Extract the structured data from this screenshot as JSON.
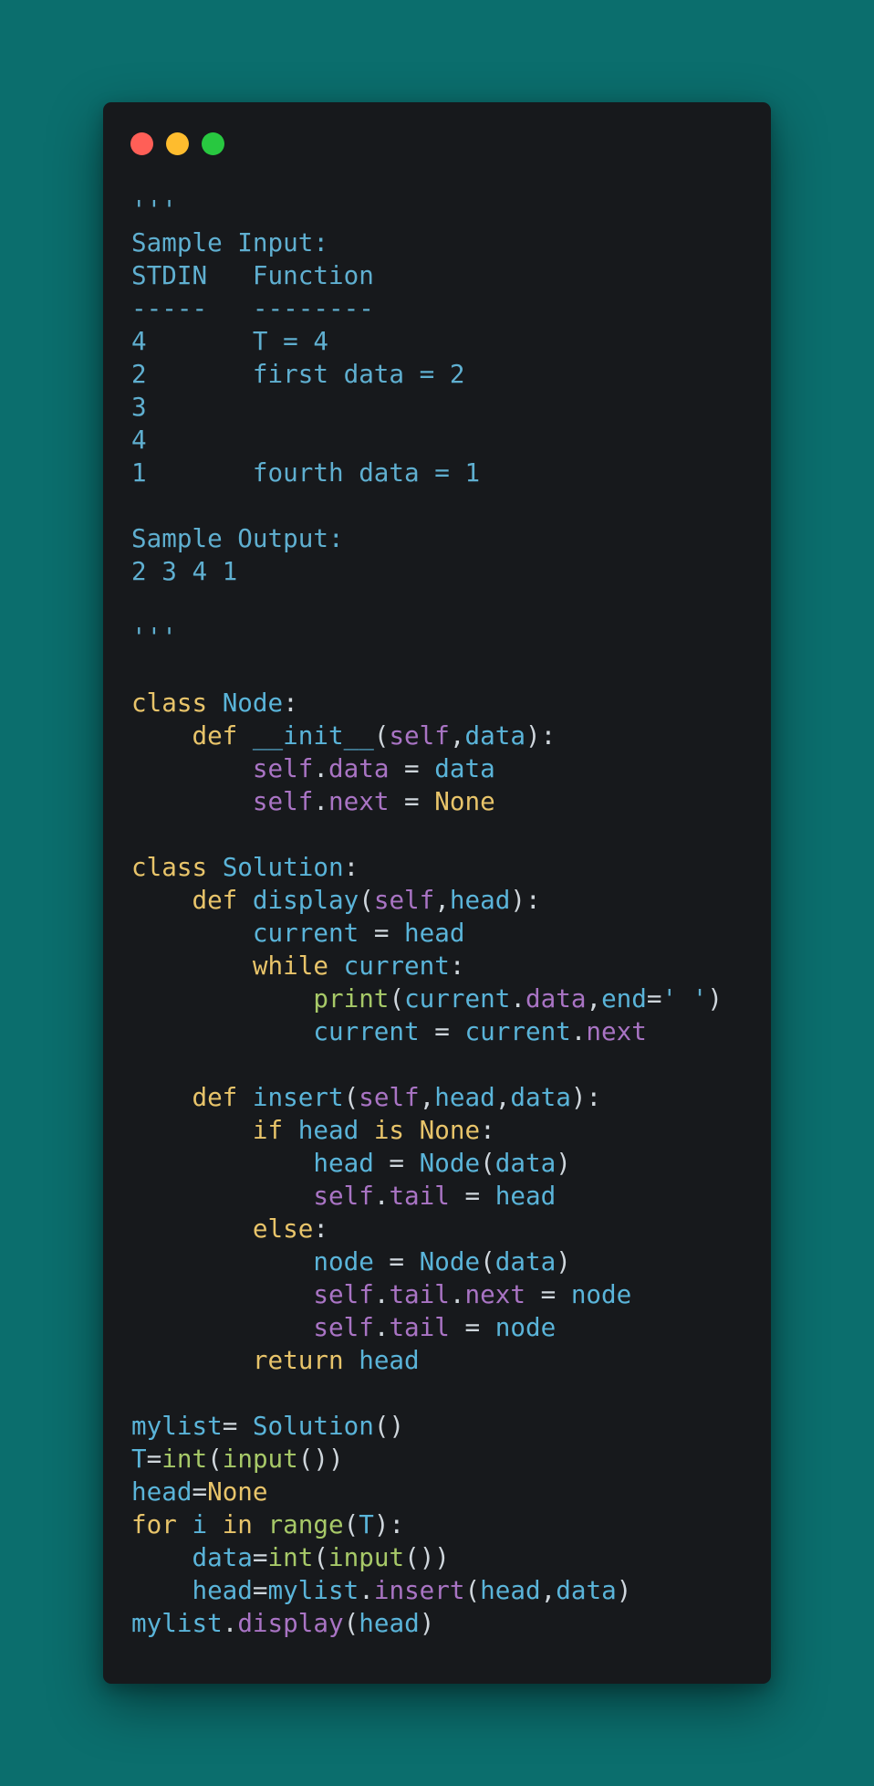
{
  "window": {
    "dots": [
      "close",
      "minimize",
      "zoom"
    ],
    "colors": {
      "background": "#0b6e6d",
      "card": "#17191c",
      "red": "#ff5f57",
      "yellow": "#febc2e",
      "green": "#28c840"
    }
  },
  "code_lines": [
    [
      [
        "str",
        "'''"
      ]
    ],
    [
      [
        "str",
        "Sample Input:"
      ]
    ],
    [
      [
        "str",
        "STDIN   Function"
      ]
    ],
    [
      [
        "str",
        "-----   --------"
      ]
    ],
    [
      [
        "str",
        "4       T = 4"
      ]
    ],
    [
      [
        "str",
        "2       first data = 2"
      ]
    ],
    [
      [
        "str",
        "3"
      ]
    ],
    [
      [
        "str",
        "4"
      ]
    ],
    [
      [
        "str",
        "1       fourth data = 1"
      ]
    ],
    [],
    [
      [
        "str",
        "Sample Output:"
      ]
    ],
    [
      [
        "str",
        "2 3 4 1"
      ]
    ],
    [],
    [
      [
        "str",
        "'''"
      ]
    ],
    [],
    [
      [
        "kw",
        "class "
      ],
      [
        "name",
        "Node"
      ],
      [
        "punc",
        ":"
      ]
    ],
    [
      [
        "plain",
        "    "
      ],
      [
        "kw",
        "def "
      ],
      [
        "func",
        "__init__"
      ],
      [
        "punc",
        "("
      ],
      [
        "self",
        "self"
      ],
      [
        "punc",
        ","
      ],
      [
        "name",
        "data"
      ],
      [
        "punc",
        "):"
      ]
    ],
    [
      [
        "plain",
        "        "
      ],
      [
        "self",
        "self"
      ],
      [
        "punc",
        "."
      ],
      [
        "attr",
        "data"
      ],
      [
        "op",
        " = "
      ],
      [
        "name",
        "data"
      ]
    ],
    [
      [
        "plain",
        "        "
      ],
      [
        "self",
        "self"
      ],
      [
        "punc",
        "."
      ],
      [
        "attr",
        "next"
      ],
      [
        "op",
        " = "
      ],
      [
        "const",
        "None"
      ]
    ],
    [],
    [
      [
        "kw",
        "class "
      ],
      [
        "name",
        "Solution"
      ],
      [
        "punc",
        ":"
      ]
    ],
    [
      [
        "plain",
        "    "
      ],
      [
        "kw",
        "def "
      ],
      [
        "func",
        "display"
      ],
      [
        "punc",
        "("
      ],
      [
        "self",
        "self"
      ],
      [
        "punc",
        ","
      ],
      [
        "name",
        "head"
      ],
      [
        "punc",
        "):"
      ]
    ],
    [
      [
        "plain",
        "        "
      ],
      [
        "name",
        "current"
      ],
      [
        "op",
        " = "
      ],
      [
        "name",
        "head"
      ]
    ],
    [
      [
        "plain",
        "        "
      ],
      [
        "kw",
        "while "
      ],
      [
        "name",
        "current"
      ],
      [
        "punc",
        ":"
      ]
    ],
    [
      [
        "plain",
        "            "
      ],
      [
        "builtin",
        "print"
      ],
      [
        "punc",
        "("
      ],
      [
        "name",
        "current"
      ],
      [
        "punc",
        "."
      ],
      [
        "attr",
        "data"
      ],
      [
        "punc",
        ","
      ],
      [
        "name",
        "end"
      ],
      [
        "op",
        "="
      ],
      [
        "str",
        "' '"
      ],
      [
        "punc",
        ")"
      ]
    ],
    [
      [
        "plain",
        "            "
      ],
      [
        "name",
        "current"
      ],
      [
        "op",
        " = "
      ],
      [
        "name",
        "current"
      ],
      [
        "punc",
        "."
      ],
      [
        "attr",
        "next"
      ]
    ],
    [],
    [
      [
        "plain",
        "    "
      ],
      [
        "kw",
        "def "
      ],
      [
        "func",
        "insert"
      ],
      [
        "punc",
        "("
      ],
      [
        "self",
        "self"
      ],
      [
        "punc",
        ","
      ],
      [
        "name",
        "head"
      ],
      [
        "punc",
        ","
      ],
      [
        "name",
        "data"
      ],
      [
        "punc",
        "):"
      ]
    ],
    [
      [
        "plain",
        "        "
      ],
      [
        "kw",
        "if "
      ],
      [
        "name",
        "head"
      ],
      [
        "kw",
        " is "
      ],
      [
        "const",
        "None"
      ],
      [
        "punc",
        ":"
      ]
    ],
    [
      [
        "plain",
        "            "
      ],
      [
        "name",
        "head"
      ],
      [
        "op",
        " = "
      ],
      [
        "name",
        "Node"
      ],
      [
        "punc",
        "("
      ],
      [
        "name",
        "data"
      ],
      [
        "punc",
        ")"
      ]
    ],
    [
      [
        "plain",
        "            "
      ],
      [
        "self",
        "self"
      ],
      [
        "punc",
        "."
      ],
      [
        "attr",
        "tail"
      ],
      [
        "op",
        " = "
      ],
      [
        "name",
        "head"
      ]
    ],
    [
      [
        "plain",
        "        "
      ],
      [
        "kw",
        "else"
      ],
      [
        "punc",
        ":"
      ]
    ],
    [
      [
        "plain",
        "            "
      ],
      [
        "name",
        "node"
      ],
      [
        "op",
        " = "
      ],
      [
        "name",
        "Node"
      ],
      [
        "punc",
        "("
      ],
      [
        "name",
        "data"
      ],
      [
        "punc",
        ")"
      ]
    ],
    [
      [
        "plain",
        "            "
      ],
      [
        "self",
        "self"
      ],
      [
        "punc",
        "."
      ],
      [
        "attr",
        "tail"
      ],
      [
        "punc",
        "."
      ],
      [
        "attr",
        "next"
      ],
      [
        "op",
        " = "
      ],
      [
        "name",
        "node"
      ]
    ],
    [
      [
        "plain",
        "            "
      ],
      [
        "self",
        "self"
      ],
      [
        "punc",
        "."
      ],
      [
        "attr",
        "tail"
      ],
      [
        "op",
        " = "
      ],
      [
        "name",
        "node"
      ]
    ],
    [
      [
        "plain",
        "        "
      ],
      [
        "kw",
        "return "
      ],
      [
        "name",
        "head"
      ]
    ],
    [],
    [
      [
        "name",
        "mylist"
      ],
      [
        "op",
        "= "
      ],
      [
        "name",
        "Solution"
      ],
      [
        "punc",
        "()"
      ]
    ],
    [
      [
        "name",
        "T"
      ],
      [
        "op",
        "="
      ],
      [
        "builtin",
        "int"
      ],
      [
        "punc",
        "("
      ],
      [
        "builtin",
        "input"
      ],
      [
        "punc",
        "())"
      ]
    ],
    [
      [
        "name",
        "head"
      ],
      [
        "op",
        "="
      ],
      [
        "const",
        "None"
      ]
    ],
    [
      [
        "kw",
        "for "
      ],
      [
        "name",
        "i"
      ],
      [
        "kw",
        " in "
      ],
      [
        "builtin",
        "range"
      ],
      [
        "punc",
        "("
      ],
      [
        "name",
        "T"
      ],
      [
        "punc",
        "):"
      ]
    ],
    [
      [
        "plain",
        "    "
      ],
      [
        "name",
        "data"
      ],
      [
        "op",
        "="
      ],
      [
        "builtin",
        "int"
      ],
      [
        "punc",
        "("
      ],
      [
        "builtin",
        "input"
      ],
      [
        "punc",
        "())"
      ]
    ],
    [
      [
        "plain",
        "    "
      ],
      [
        "name",
        "head"
      ],
      [
        "op",
        "="
      ],
      [
        "name",
        "mylist"
      ],
      [
        "punc",
        "."
      ],
      [
        "attr",
        "insert"
      ],
      [
        "punc",
        "("
      ],
      [
        "name",
        "head"
      ],
      [
        "punc",
        ","
      ],
      [
        "name",
        "data"
      ],
      [
        "punc",
        ")"
      ]
    ],
    [
      [
        "name",
        "mylist"
      ],
      [
        "punc",
        "."
      ],
      [
        "attr",
        "display"
      ],
      [
        "punc",
        "("
      ],
      [
        "name",
        "head"
      ],
      [
        "punc",
        ")"
      ]
    ]
  ]
}
